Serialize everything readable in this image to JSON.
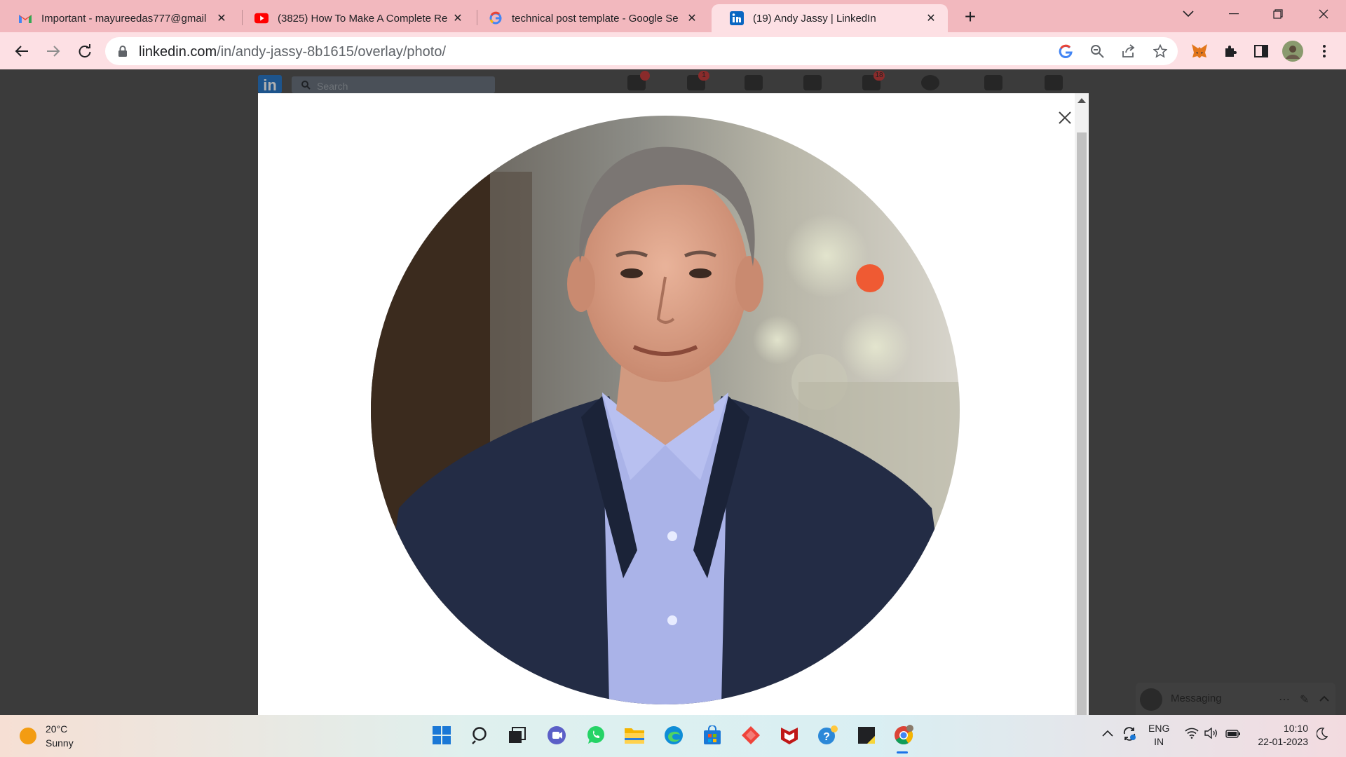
{
  "browser": {
    "tabs": [
      {
        "title": "Important - mayureedas777@gmail",
        "favicon": "gmail-icon"
      },
      {
        "title": "(3825) How To Make A Complete Re",
        "favicon": "youtube-icon"
      },
      {
        "title": "technical post template - Google Se",
        "favicon": "google-icon"
      },
      {
        "title": "(19) Andy Jassy | LinkedIn",
        "favicon": "linkedin-icon",
        "active": true
      }
    ],
    "url_host": "linkedin.com",
    "url_path": "/in/andy-jassy-8b1615/overlay/photo/"
  },
  "linkedin": {
    "search_placeholder": "Search",
    "badges": {
      "home": "",
      "network": "1",
      "notifications": "18"
    }
  },
  "messaging": {
    "label": "Messaging"
  },
  "taskbar": {
    "weather_temp": "20°C",
    "weather_condition": "Sunny",
    "lang_line1": "ENG",
    "lang_line2": "IN",
    "time": "10:10",
    "date": "22-01-2023"
  },
  "colors": {
    "tab_strip": "#f2b8be",
    "toolbar": "#fde0e4",
    "linkedin_blue": "#0a66c2"
  }
}
